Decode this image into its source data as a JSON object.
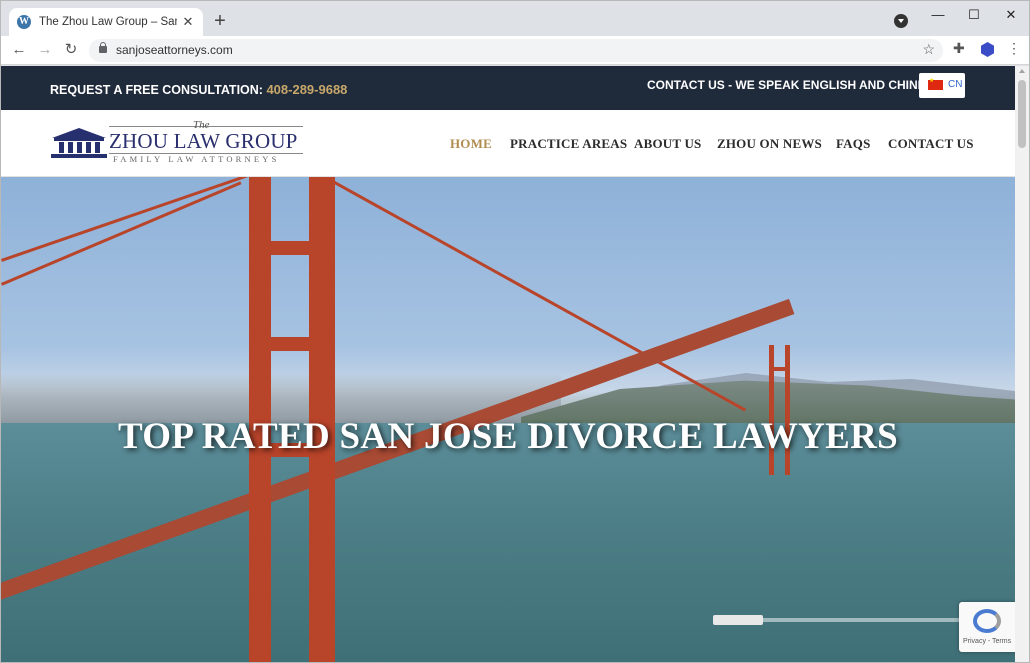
{
  "browser": {
    "tab_title": "The Zhou Law Group – San Jose D",
    "tab_favicon": "wordpress-icon",
    "url": "sanjoseattorneys.com",
    "new_tab_label": "+",
    "icons": [
      "back-arrow-icon",
      "forward-arrow-icon",
      "reload-icon",
      "lock-icon",
      "star-icon",
      "puzzle-extension-icon",
      "cube-extension-icon",
      "kebab-menu-icon"
    ]
  },
  "topbar": {
    "consult_label": "REQUEST A FREE CONSULTATION:",
    "phone": "408-289-9688",
    "contact_label": "CONTACT US - WE SPEAK ENGLISH AND CHINESE",
    "lang_code": "CN",
    "phone_color": "#c7a86a",
    "bg_color": "#1f2a3b"
  },
  "logo": {
    "the": "The",
    "name": "ZHOU LAW GROUP",
    "tagline": "FAMILY LAW ATTORNEYS"
  },
  "nav": {
    "items": [
      {
        "label": "HOME",
        "active": true
      },
      {
        "label": "PRACTICE AREAS",
        "active": false
      },
      {
        "label": "ABOUT US",
        "active": false
      },
      {
        "label": "ZHOU ON NEWS",
        "active": false
      },
      {
        "label": "FAQS",
        "active": false
      },
      {
        "label": "CONTACT US",
        "active": false
      }
    ],
    "active_color": "#b08c4f"
  },
  "hero": {
    "title": "TOP RATED SAN JOSE DIVORCE LAWYERS"
  },
  "recaptcha": {
    "text": "Privacy - Terms"
  }
}
